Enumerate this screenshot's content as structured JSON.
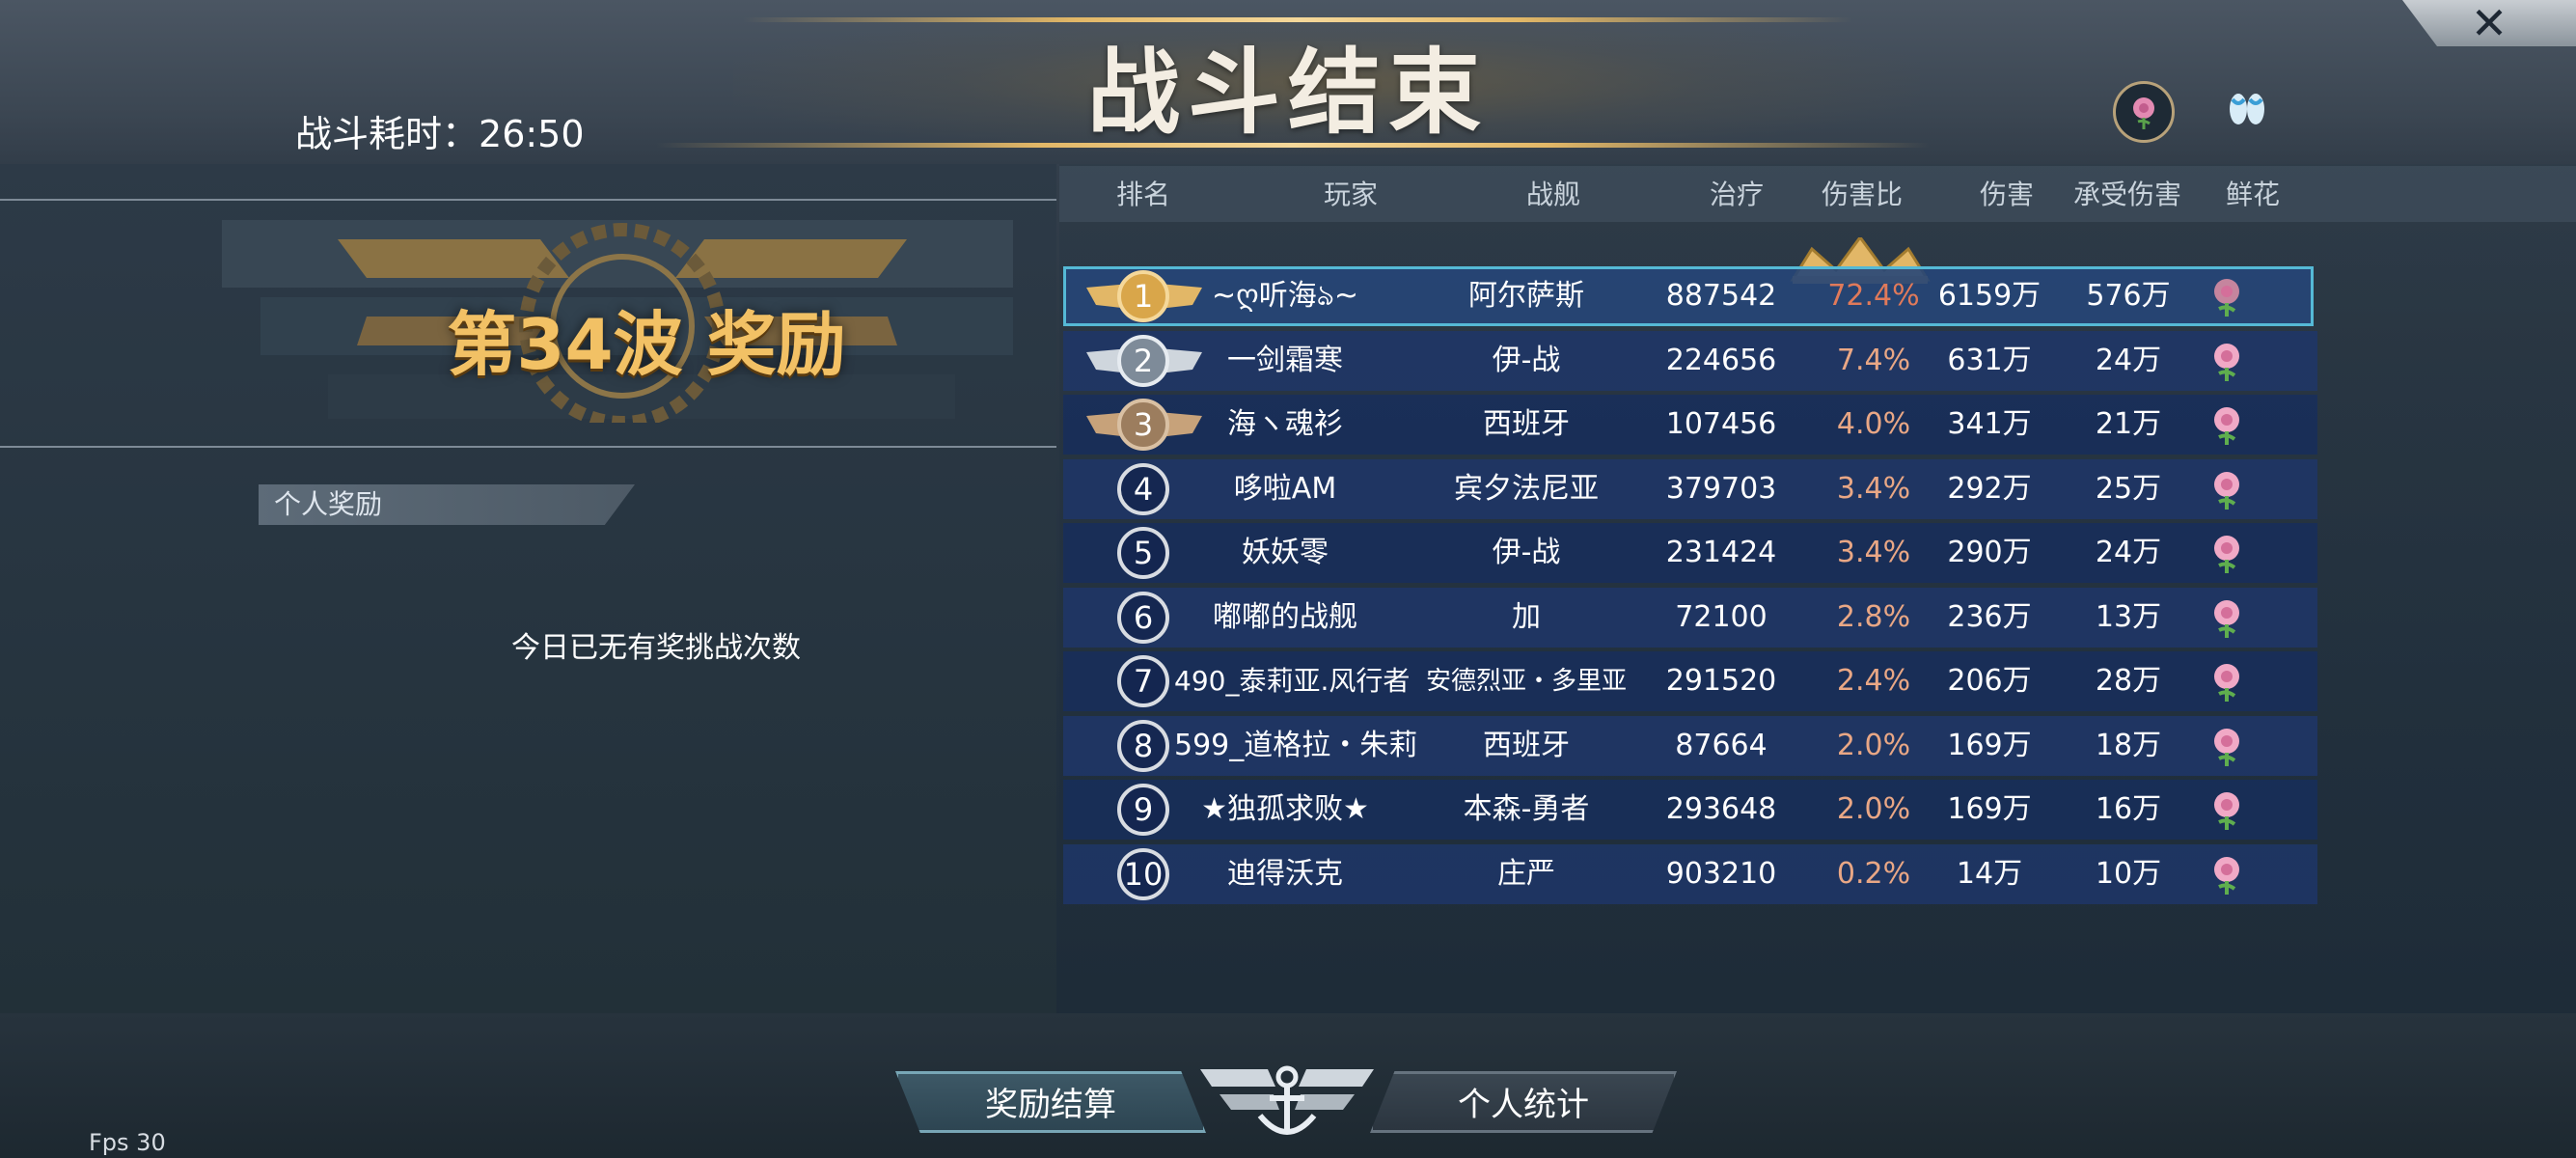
{
  "title": "战斗结束",
  "battle_time_label": "战斗耗时：",
  "battle_time_value": "26:50",
  "close_label": "✕",
  "wave": {
    "title": "第34波 奖励"
  },
  "personal_tab": "个人奖励",
  "no_reward_text": "今日已无有奖挑战次数",
  "table": {
    "headers": [
      "排名",
      "玩家",
      "战舰",
      "治疗",
      "伤害比",
      "伤害",
      "承受伤害",
      "鲜花"
    ],
    "rows": [
      {
        "rank": "1",
        "player": "~ღ听海ঌ~",
        "ship": "阿尔萨斯",
        "heal": "887542",
        "ratio": "72.4%",
        "damage": "6159万",
        "taken": "576万"
      },
      {
        "rank": "2",
        "player": "一剑霜寒",
        "ship": "伊-战",
        "heal": "224656",
        "ratio": "7.4%",
        "damage": "631万",
        "taken": "24万"
      },
      {
        "rank": "3",
        "player": "海ヽ魂衫",
        "ship": "西班牙",
        "heal": "107456",
        "ratio": "4.0%",
        "damage": "341万",
        "taken": "21万"
      },
      {
        "rank": "4",
        "player": "哆啦AM",
        "ship": "宾夕法尼亚",
        "heal": "379703",
        "ratio": "3.4%",
        "damage": "292万",
        "taken": "25万"
      },
      {
        "rank": "5",
        "player": "妖妖零",
        "ship": "伊-战",
        "heal": "231424",
        "ratio": "3.4%",
        "damage": "290万",
        "taken": "24万"
      },
      {
        "rank": "6",
        "player": "嘟嘟的战舰",
        "ship": "加",
        "heal": "72100",
        "ratio": "2.8%",
        "damage": "236万",
        "taken": "13万"
      },
      {
        "rank": "7",
        "player": "490_泰莉亚.风行者",
        "ship": "安德烈亚・多里亚",
        "heal": "291520",
        "ratio": "2.4%",
        "damage": "206万",
        "taken": "28万"
      },
      {
        "rank": "8",
        "player": "599_道格拉・朱莉",
        "ship": "西班牙",
        "heal": "87664",
        "ratio": "2.0%",
        "damage": "169万",
        "taken": "18万"
      },
      {
        "rank": "9",
        "player": "★独孤求败★",
        "ship": "本森-勇者",
        "heal": "293648",
        "ratio": "2.0%",
        "damage": "169万",
        "taken": "16万"
      },
      {
        "rank": "10",
        "player": "迪得沃克",
        "ship": "庄严",
        "heal": "903210",
        "ratio": "0.2%",
        "damage": "14万",
        "taken": "10万"
      }
    ]
  },
  "buttons": {
    "reward_settle": "奖励结算",
    "personal_stats": "个人统计"
  },
  "fps_text": "Fps 30",
  "colors": {
    "gold": "#f2c165",
    "row_bg": "#1e3668",
    "highlight_border": "#55b9d6",
    "ratio_red": "#e07a5a"
  }
}
